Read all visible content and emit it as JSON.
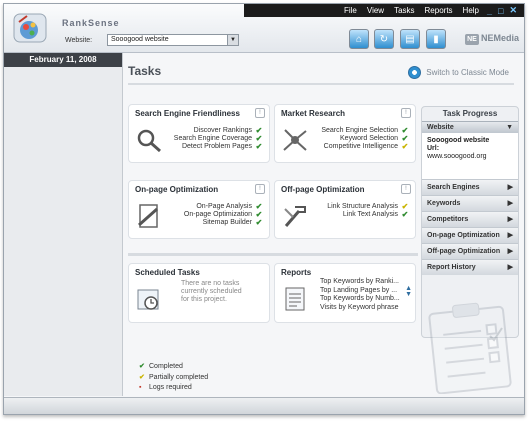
{
  "app": {
    "brand": "RankSense",
    "vendor": "NEMedia"
  },
  "menu": [
    "File",
    "View",
    "Tasks",
    "Reports",
    "Help"
  ],
  "window_controls": [
    "_",
    "□",
    "✕"
  ],
  "website": {
    "label": "Website:",
    "value": "Sooogood website"
  },
  "toolbar_icons": [
    "home-icon",
    "refresh-icon",
    "settings-icon",
    "export-icon"
  ],
  "date": "February 11, 2008",
  "main": {
    "title": "Tasks",
    "switch_label": "Switch to Classic Mode"
  },
  "cards": {
    "sef": {
      "title": "Search Engine Friendliness",
      "badge": "!",
      "icon": "magnifier-icon",
      "items": [
        {
          "label": "Discover Rankings",
          "status": "completed"
        },
        {
          "label": "Search Engine Coverage",
          "status": "completed"
        },
        {
          "label": "Detect Problem Pages",
          "status": "completed"
        }
      ]
    },
    "mr": {
      "title": "Market Research",
      "badge": "!",
      "icon": "network-icon",
      "items": [
        {
          "label": "Search Engine Selection",
          "status": "completed"
        },
        {
          "label": "Keyword Selection",
          "status": "completed"
        },
        {
          "label": "Competitive Intelligence",
          "status": "partial"
        }
      ]
    },
    "onpage": {
      "title": "On-page Optimization",
      "badge": "!",
      "icon": "document-icon",
      "items": [
        {
          "label": "On-Page Analysis",
          "status": "completed"
        },
        {
          "label": "On-page Optimization",
          "status": "completed"
        },
        {
          "label": "Sitemap Builder",
          "status": "completed"
        }
      ]
    },
    "offpage": {
      "title": "Off-page Optimization",
      "badge": "!",
      "icon": "tools-icon",
      "items": [
        {
          "label": "Link Structure Analysis",
          "status": "partial"
        },
        {
          "label": "Link Text Analysis",
          "status": "completed"
        }
      ]
    },
    "scheduled": {
      "title": "Scheduled Tasks",
      "icon": "calendar-icon",
      "text": [
        "There are no tasks",
        "currently scheduled",
        "for this project."
      ]
    },
    "reports": {
      "title": "Reports",
      "icon": "report-icon",
      "items": [
        "Top Keywords by Ranki...",
        "Top Landing Pages by ...",
        "Top Keywords by Numb...",
        "Visits by Keyword phrase"
      ]
    }
  },
  "progress": {
    "title": "Task Progress",
    "website_header": "Website",
    "website_name": "Sooogood website",
    "url_label": "Url:",
    "url": "www.sooogood.org",
    "sections": [
      "Search Engines",
      "Keywords",
      "Competitors",
      "On-page Optimization",
      "Off-page Optimization",
      "Report History"
    ]
  },
  "legend": [
    {
      "label": "Completed",
      "mark": "✔",
      "color": "#2f8b2f"
    },
    {
      "label": "Partially completed",
      "mark": "✔",
      "color": "#c9b400"
    },
    {
      "label": "Logs required",
      "mark": "▪",
      "color": "#c23a2b"
    }
  ]
}
